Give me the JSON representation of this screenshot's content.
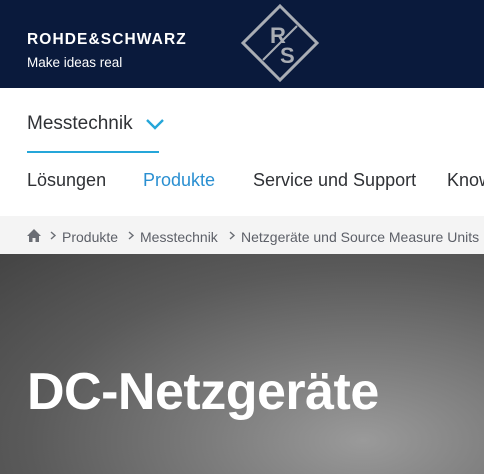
{
  "header": {
    "brand_name": "ROHDE&SCHWARZ",
    "tagline": "Make ideas real",
    "logo_text": "R&S",
    "colors": {
      "background": "#0a1a3c",
      "logo": "#a9adb4"
    }
  },
  "category_selector": {
    "label": "Messtechnik",
    "icon": "chevron-down-icon",
    "accent": "#25a6d9"
  },
  "nav": {
    "items": [
      {
        "label": "Lösungen",
        "active": false
      },
      {
        "label": "Produkte",
        "active": true
      },
      {
        "label": "Service und Support",
        "active": false
      },
      {
        "label": "Know",
        "active": false
      }
    ],
    "active_color": "#2a8fd1"
  },
  "breadcrumb": {
    "home_icon": "home-icon",
    "items": [
      "Produkte",
      "Messtechnik",
      "Netzgeräte und Source Measure Units"
    ]
  },
  "hero": {
    "title": "DC-Netzgeräte"
  }
}
